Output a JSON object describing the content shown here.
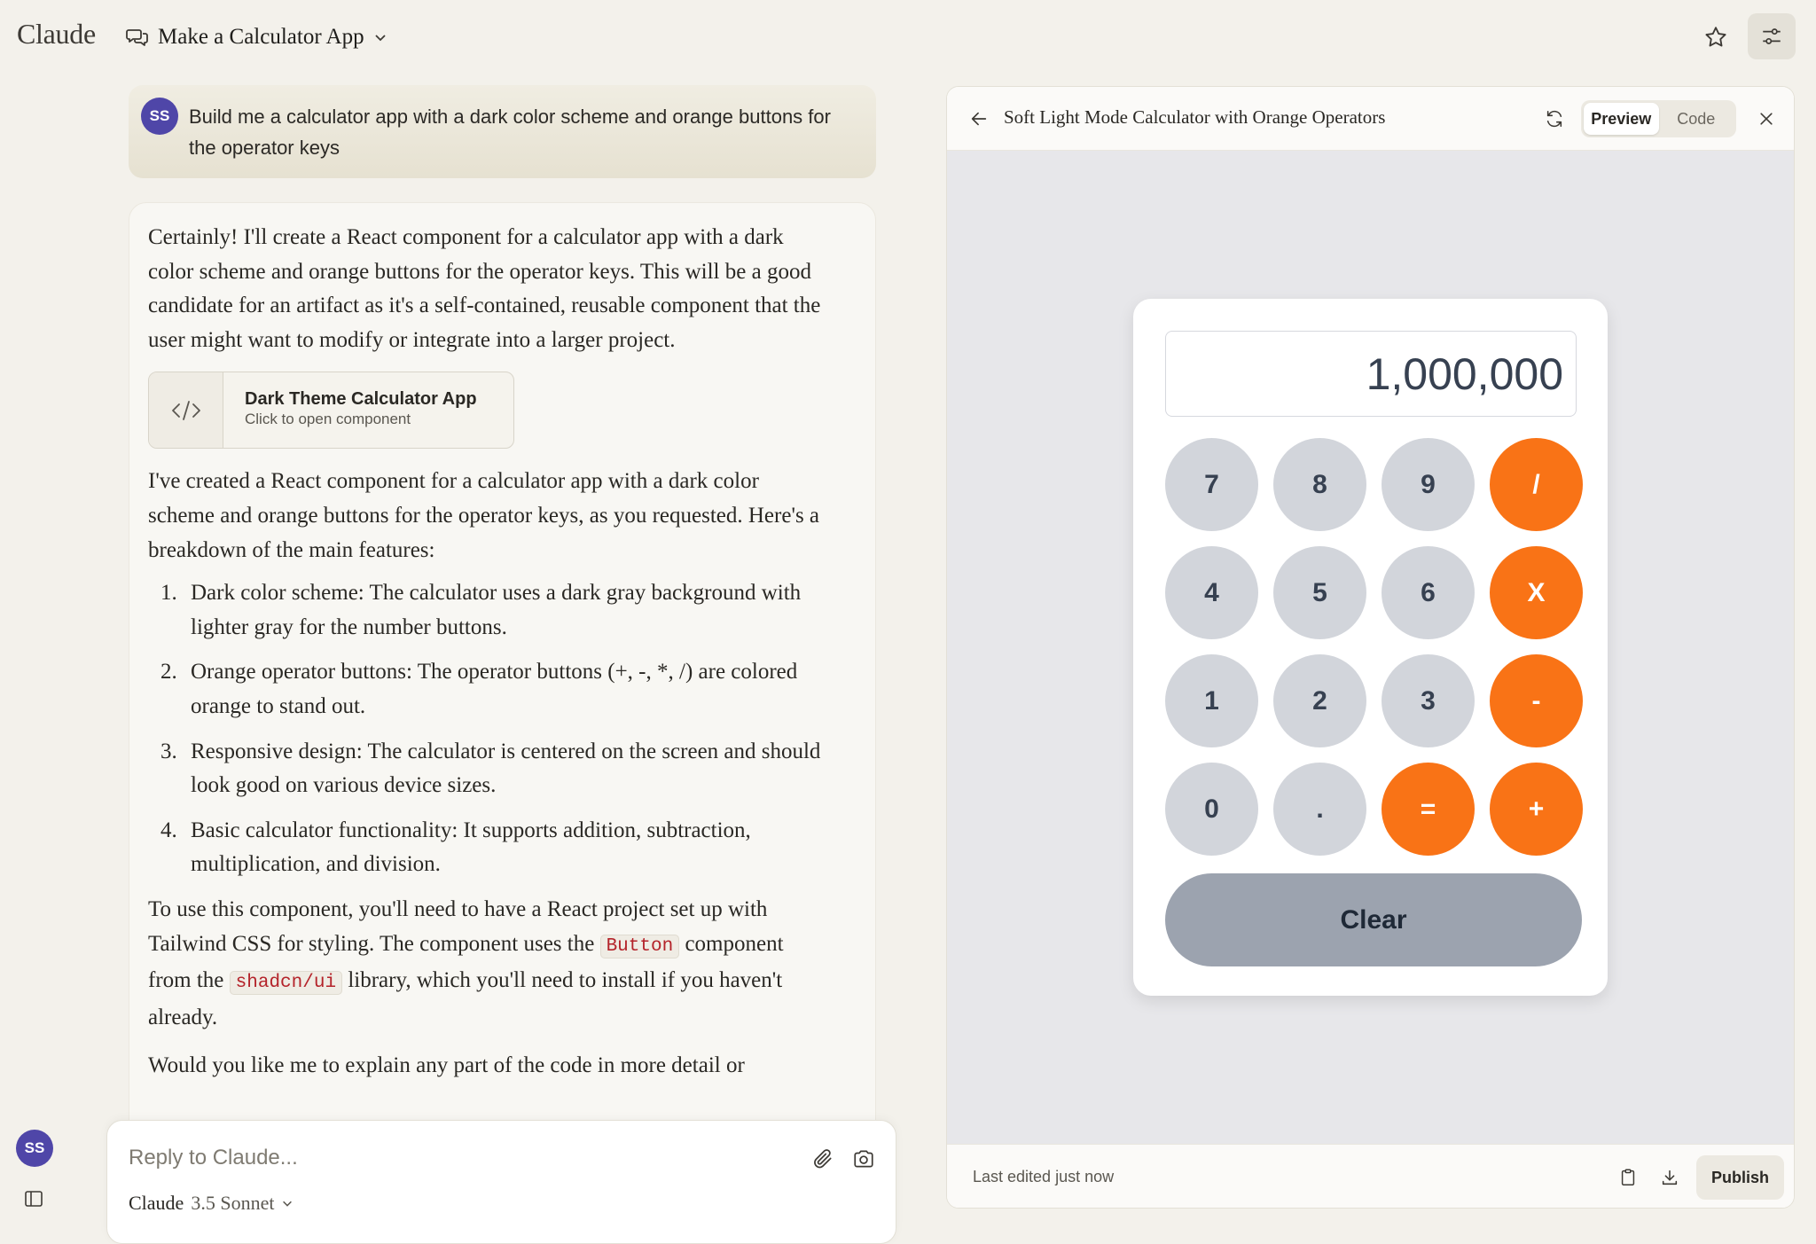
{
  "header": {
    "logo": "Claude",
    "chat_title": "Make a Calculator App",
    "icons": {
      "chat": "chat-bubbles-icon",
      "dropdown": "chevron-down-icon",
      "star": "star-icon",
      "settings": "sliders-icon"
    }
  },
  "rail": {
    "avatar_initials": "SS",
    "panel_icon": "sidebar-toggle-icon"
  },
  "user_message": {
    "avatar_initials": "SS",
    "text": "Build me a calculator app with a dark color scheme and orange buttons for the operator keys"
  },
  "assistant": {
    "intro": "Certainly! I'll create a React component for a calculator app with a dark color scheme and orange buttons for the operator keys. This will be a good candidate for an artifact as it's a self-contained, reusable component that the user might want to modify or integrate into a larger project.",
    "artifact": {
      "title": "Dark Theme Calculator App",
      "subtitle": "Click to open component",
      "icon": "code-icon"
    },
    "summary": "I've created a React component for a calculator app with a dark color scheme and orange buttons for the operator keys, as you requested. Here's a breakdown of the main features:",
    "features": [
      {
        "num": "1.",
        "text": "Dark color scheme: The calculator uses a dark gray background with lighter gray for the number buttons."
      },
      {
        "num": "2.",
        "text": "Orange operator buttons: The operator buttons (+, -, *, /) are colored orange to stand out."
      },
      {
        "num": "3.",
        "text": "Responsive design: The calculator is centered on the screen and should look good on various device sizes."
      },
      {
        "num": "4.",
        "text": "Basic calculator functionality: It supports addition, subtraction, multiplication, and division."
      }
    ],
    "usage": {
      "part1": "To use this component, you'll need to have a React project set up with Tailwind CSS for styling. The component uses the ",
      "code1": "Button",
      "part2": " component from the ",
      "code2": "shadcn/ui",
      "part3": " library, which you'll need to install if you haven't already."
    },
    "closing": "Would you like me to explain any part of the code in more detail or"
  },
  "reply": {
    "placeholder": "Reply to Claude...",
    "model_name": "Claude",
    "model_version": "3.5 Sonnet",
    "icons": {
      "attach": "paperclip-icon",
      "camera": "camera-icon"
    }
  },
  "panel": {
    "title": "Soft Light Mode Calculator with Orange Operators",
    "tabs": {
      "preview": "Preview",
      "code": "Code"
    },
    "active_tab": "Preview",
    "footer": {
      "last_edited": "Last edited just now",
      "publish": "Publish"
    },
    "icons": {
      "back": "arrow-left-icon",
      "refresh": "refresh-icon",
      "close": "close-icon",
      "copy": "clipboard-icon",
      "download": "download-icon"
    }
  },
  "calculator": {
    "display": "1,000,000",
    "rows": [
      [
        "7",
        "8",
        "9",
        "/"
      ],
      [
        "4",
        "5",
        "6",
        "X"
      ],
      [
        "1",
        "2",
        "3",
        "-"
      ],
      [
        "0",
        ".",
        "=",
        "+"
      ]
    ],
    "clear_label": "Clear",
    "colors": {
      "number_key": "#d2d5db",
      "operator_key": "#f97316",
      "clear_key": "#9ca3af"
    }
  }
}
